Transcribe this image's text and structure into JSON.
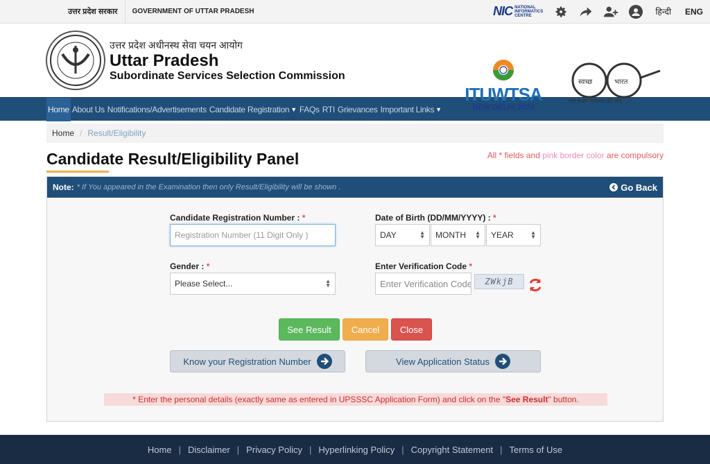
{
  "topbar": {
    "hindi_gov": "उत्तर प्रदेश सरकार",
    "english_gov": "GOVERNMENT OF UTTAR PRADESH",
    "nic_logo": "NIC",
    "nic_text": [
      "NATIONAL",
      "INFORMATICS",
      "CENTRE"
    ],
    "lang_hindi": "हिन्दी",
    "lang_eng": "ENG",
    "icons": [
      "gear-icon",
      "share-icon",
      "users-icon",
      "contrast-icon"
    ]
  },
  "header": {
    "title_hindi": "उत्तर प्रदेश अधीनस्थ सेवा चयन आयोग",
    "title_line1": "Uttar Pradesh",
    "title_line2": "Subordinate Services Selection Commission",
    "itu_word": "ITUWTSA",
    "itu_city": "NEW DELHI 2024",
    "swachh_left": "स्वच्छ",
    "swachh_right": "भारत",
    "swachh_tagline": "एक कदम स्वच्छता की ओर"
  },
  "nav": {
    "items": [
      {
        "label": "Home",
        "active": true
      },
      {
        "label": "About Us"
      },
      {
        "label": "Notifications/Advertisements"
      },
      {
        "label": "Candidate Registration",
        "caret": true
      },
      {
        "label": "FAQs"
      },
      {
        "label": "RTI"
      },
      {
        "label": "Grievances"
      },
      {
        "label": "Important Links",
        "caret": true
      }
    ]
  },
  "breadcrumb": {
    "home": "Home",
    "current": "Result/Eligibility"
  },
  "page": {
    "title": "Candidate Result/Eligibility Panel",
    "req_all": "All * fields and ",
    "req_pink": "pink border color",
    "req_end": " are compulsory"
  },
  "panel": {
    "note_label": "Note:",
    "note_text": "* If You appeared in the Examination then only Result/Eligibility will be shown .",
    "go_back": "Go Back",
    "reg_label": "Candidate Registration Number : ",
    "reg_placeholder": "Registration Number (11 Digit Only )",
    "dob_label": "Date of Birth (DD/MM/YYYY) : ",
    "dob_day": "DAY",
    "dob_month": "MONTH",
    "dob_year": "YEAR",
    "gender_label": "Gender : ",
    "gender_value": "Please Select...",
    "verify_label": "Enter Verification Code ",
    "verify_placeholder": "Enter Verification Code",
    "captcha_text": "ZWkjB",
    "star": "*",
    "btn_see": "See Result",
    "btn_cancel": "Cancel",
    "btn_close": "Close",
    "btn_know": "Know your Registration Number",
    "btn_status": "View Application Status",
    "instr_start": "* Enter the personal details (exactly same as entered in UPSSSC Application Form) and click on the \"",
    "instr_bold": "See Result",
    "instr_end": " \" button."
  },
  "footer": {
    "links": [
      "Home",
      "Disclaimer",
      "Privacy Policy",
      "Hyperlinking Policy",
      "Copyright Statement",
      "Terms of Use"
    ]
  },
  "colors": {
    "nav": "#1f4e79",
    "footer": "#1a2b44",
    "accent": "#e8b24a"
  }
}
